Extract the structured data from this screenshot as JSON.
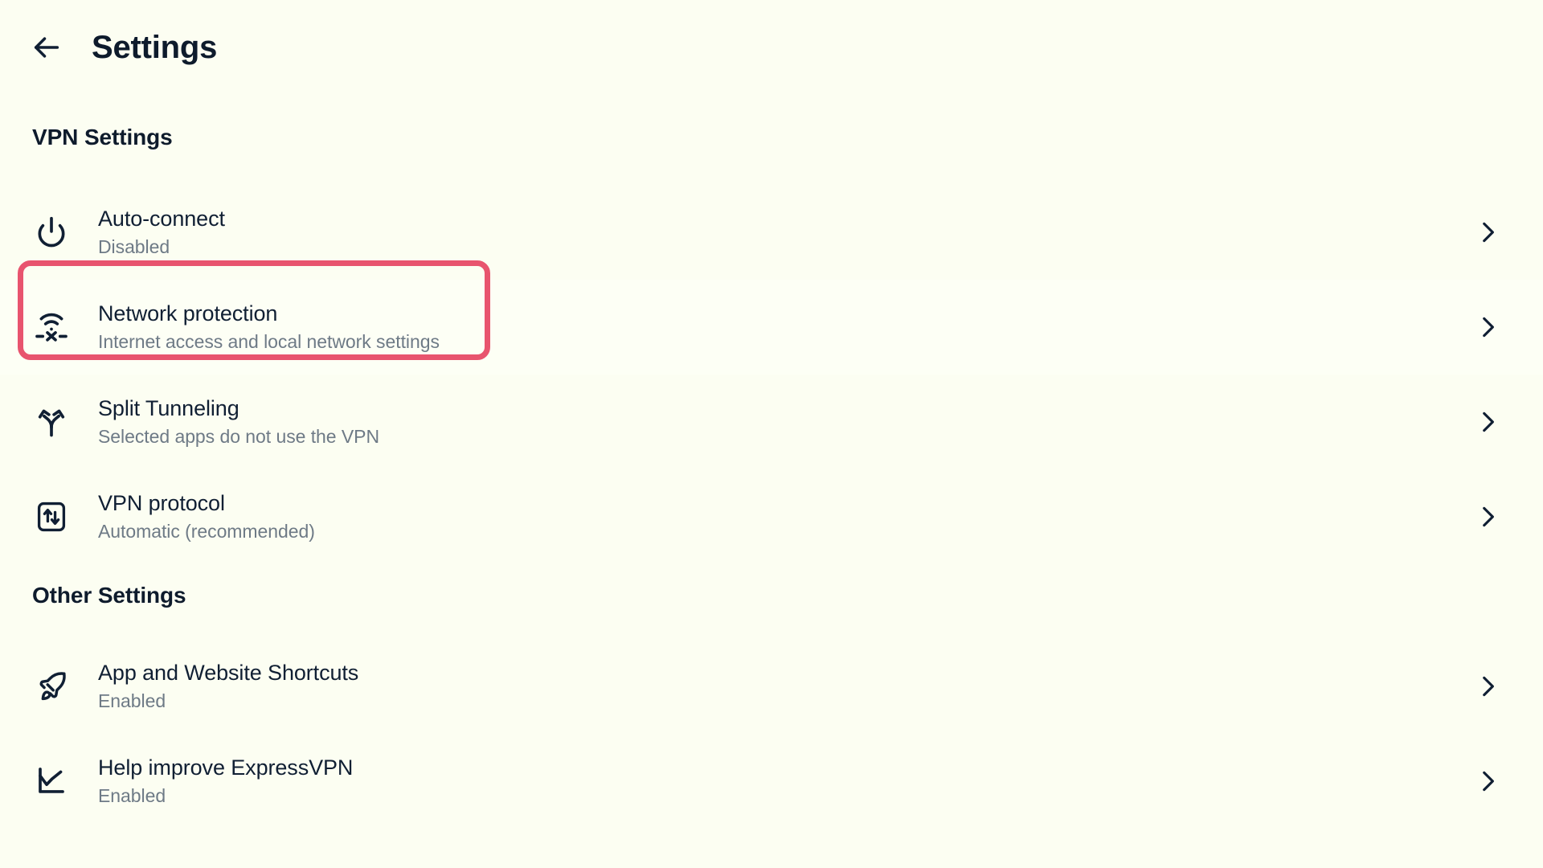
{
  "header": {
    "back_icon": "arrow-left-icon",
    "title": "Settings"
  },
  "colors": {
    "background": "#FCFEF2",
    "row_hover": "#FDFFF5",
    "text_primary": "#101F33",
    "text_secondary": "#6E7A86",
    "highlight_border": "#E8546E"
  },
  "sections": [
    {
      "id": "vpn",
      "heading": "VPN Settings",
      "items": [
        {
          "icon": "power-icon",
          "title": "Auto-connect",
          "subtitle": "Disabled",
          "chevron": "chevron-right-icon",
          "hovered": false,
          "highlighted": false
        },
        {
          "icon": "network-protection-icon",
          "title": "Network protection",
          "subtitle": "Internet access and local network settings",
          "chevron": "chevron-right-icon",
          "hovered": true,
          "highlighted": true
        },
        {
          "icon": "split-tunneling-icon",
          "title": "Split Tunneling",
          "subtitle": "Selected apps do not use the VPN",
          "chevron": "chevron-right-icon",
          "hovered": false,
          "highlighted": false
        },
        {
          "icon": "vpn-protocol-icon",
          "title": "VPN protocol",
          "subtitle": "Automatic (recommended)",
          "chevron": "chevron-right-icon",
          "hovered": false,
          "highlighted": false
        }
      ]
    },
    {
      "id": "other",
      "heading": "Other Settings",
      "items": [
        {
          "icon": "rocket-icon",
          "title": "App and Website Shortcuts",
          "subtitle": "Enabled",
          "chevron": "chevron-right-icon",
          "hovered": false,
          "highlighted": false
        },
        {
          "icon": "line-chart-icon",
          "title": "Help improve ExpressVPN",
          "subtitle": "Enabled",
          "chevron": "chevron-right-icon",
          "hovered": false,
          "highlighted": false
        }
      ]
    }
  ]
}
